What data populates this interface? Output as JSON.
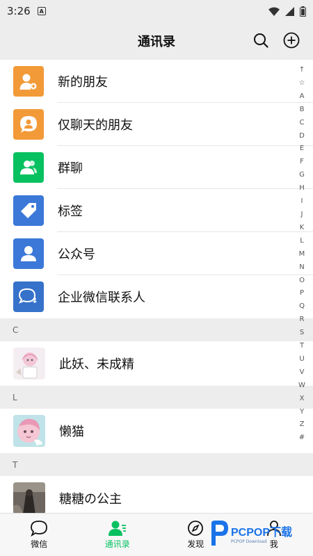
{
  "status_bar": {
    "time": "3:26",
    "notif_badge": "A"
  },
  "header": {
    "title": "通讯录",
    "search_icon": "search-icon",
    "add_icon": "add-circle-icon"
  },
  "functions": [
    {
      "label": "新的朋友",
      "color": "#f29a38",
      "icon": "add-friend-icon"
    },
    {
      "label": "仅聊天的朋友",
      "color": "#f29a38",
      "icon": "chat-only-friend-icon"
    },
    {
      "label": "群聊",
      "color": "#07c160",
      "icon": "group-chat-icon"
    },
    {
      "label": "标签",
      "color": "#3b78d8",
      "icon": "tag-icon"
    },
    {
      "label": "公众号",
      "color": "#3b78d8",
      "icon": "official-account-icon"
    },
    {
      "label": "企业微信联系人",
      "color": "#3672c9",
      "icon": "work-wechat-icon"
    }
  ],
  "sections": [
    {
      "letter": "C",
      "contacts": [
        {
          "name": "此妖、未成精"
        }
      ]
    },
    {
      "letter": "L",
      "contacts": [
        {
          "name": "懒猫"
        }
      ]
    },
    {
      "letter": "T",
      "contacts": [
        {
          "name": "糖糖の公主"
        }
      ]
    }
  ],
  "alpha_index": [
    "↑",
    "☆",
    "A",
    "B",
    "C",
    "D",
    "E",
    "F",
    "G",
    "H",
    "I",
    "J",
    "K",
    "L",
    "M",
    "N",
    "O",
    "P",
    "Q",
    "R",
    "S",
    "T",
    "U",
    "V",
    "W",
    "X",
    "Y",
    "Z",
    "#"
  ],
  "tabs": [
    {
      "label": "微信",
      "icon": "chat-bubble-icon",
      "active": false
    },
    {
      "label": "通讯录",
      "icon": "contacts-icon",
      "active": true
    },
    {
      "label": "发现",
      "icon": "compass-icon",
      "active": false
    },
    {
      "label": "我",
      "icon": "me-icon",
      "active": false
    }
  ],
  "watermark": {
    "brand": "PCPOP下载",
    "sub": "PCPOP Download"
  },
  "colors": {
    "accent": "#07c160",
    "background": "#ededed"
  }
}
